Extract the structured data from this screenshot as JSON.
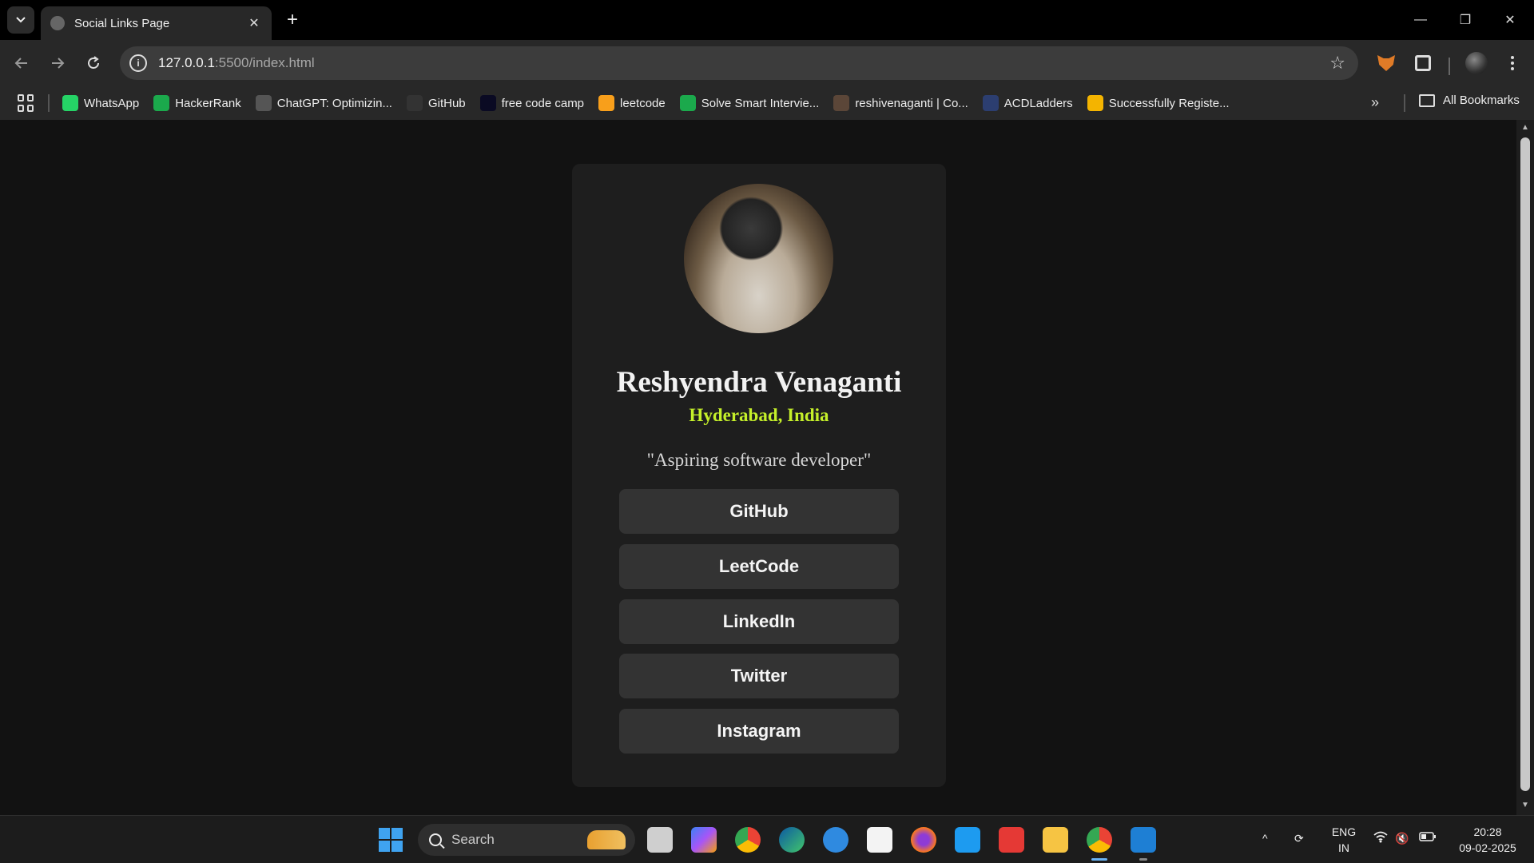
{
  "browser": {
    "tab_title": "Social Links Page",
    "tab_close": "✕",
    "new_tab": "+",
    "url_host": "127.0.0.1",
    "url_rest": ":5500/index.html",
    "window_controls": {
      "minimize": "—",
      "restore": "❐",
      "close": "✕"
    }
  },
  "bookmarks": {
    "items": [
      {
        "label": "WhatsApp",
        "icon": "whatsapp-icon",
        "color": "#25d366"
      },
      {
        "label": "HackerRank",
        "icon": "hackerrank-icon",
        "color": "#1ba94c"
      },
      {
        "label": "ChatGPT: Optimizin...",
        "icon": "chatgpt-icon",
        "color": "#555555"
      },
      {
        "label": "GitHub",
        "icon": "github-icon",
        "color": "#333333"
      },
      {
        "label": "free code camp",
        "icon": "freecodecamp-icon",
        "color": "#0a0a23"
      },
      {
        "label": "leetcode",
        "icon": "leetcode-icon",
        "color": "#f89f1b"
      },
      {
        "label": "Solve Smart Intervie...",
        "icon": "hackerrank-icon",
        "color": "#1ba94c"
      },
      {
        "label": "reshivenaganti | Co...",
        "icon": "codechef-icon",
        "color": "#5b4638"
      },
      {
        "label": "ACDLadders",
        "icon": "acdladders-icon",
        "color": "#2c3e70"
      },
      {
        "label": "Successfully Registe...",
        "icon": "chart-icon",
        "color": "#f4b400"
      }
    ],
    "overflow": "»",
    "all_bookmarks": "All Bookmarks"
  },
  "profile": {
    "name": "Reshyendra Venaganti",
    "location": "Hyderabad, India",
    "bio": "\"Aspiring software developer\"",
    "links": [
      {
        "label": "GitHub"
      },
      {
        "label": "LeetCode"
      },
      {
        "label": "LinkedIn"
      },
      {
        "label": "Twitter"
      },
      {
        "label": "Instagram"
      }
    ]
  },
  "taskbar": {
    "search_placeholder": "Search",
    "lang_line1": "ENG",
    "lang_line2": "IN",
    "time": "20:28",
    "date": "09-02-2025"
  },
  "colors": {
    "page_bg": "#121212",
    "card_bg": "#1e1e1e",
    "button_bg": "#333333",
    "location_accent": "#c5f02a"
  }
}
